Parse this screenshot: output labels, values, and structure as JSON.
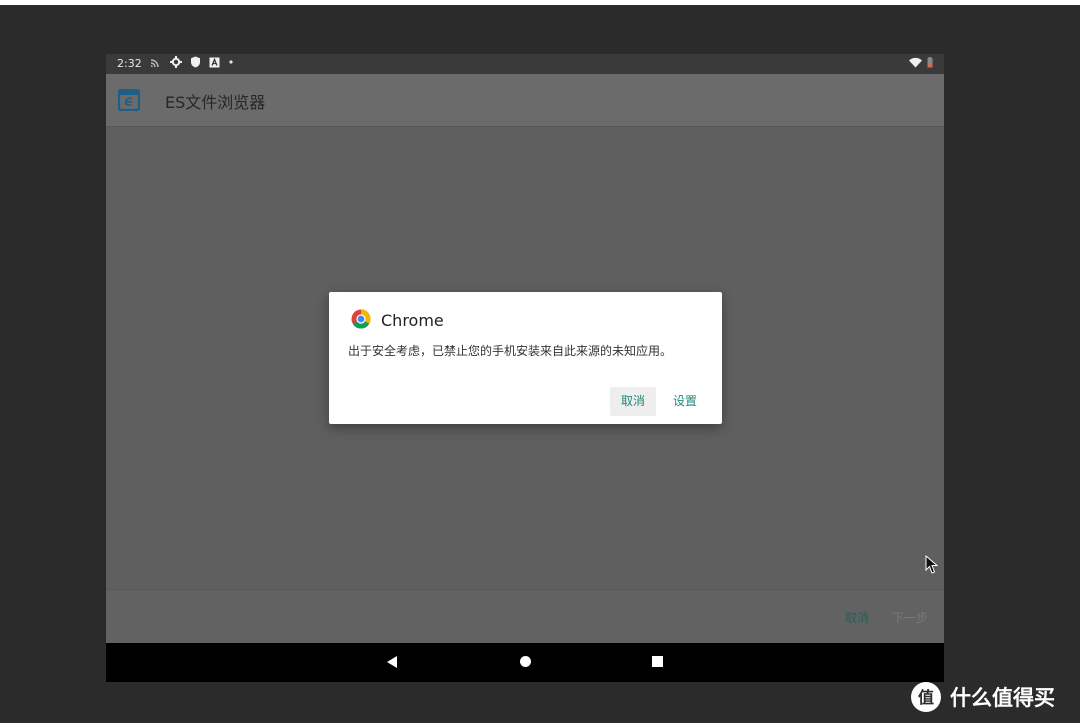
{
  "status_bar": {
    "time": "2:32",
    "icons": [
      "cast-icon",
      "gear-icon",
      "shield-icon",
      "a-box-icon",
      "dot-icon",
      "wifi-icon",
      "battery-icon"
    ]
  },
  "app_bar": {
    "title": "ES文件浏览器",
    "icon": "es-file-explorer-icon"
  },
  "dialog": {
    "title": "Chrome",
    "message": "出于安全考虑，已禁止您的手机安装来自此来源的未知应用。",
    "cancel_label": "取消",
    "settings_label": "设置"
  },
  "bottom_bar": {
    "cancel_label": "取消",
    "next_label": "下一步"
  },
  "watermark": {
    "text": "什么值得买",
    "logo_char": "值"
  },
  "colors": {
    "accent": "#1f8a7c",
    "scrim": "#5f5f5f",
    "background": "#2b2b2b"
  }
}
